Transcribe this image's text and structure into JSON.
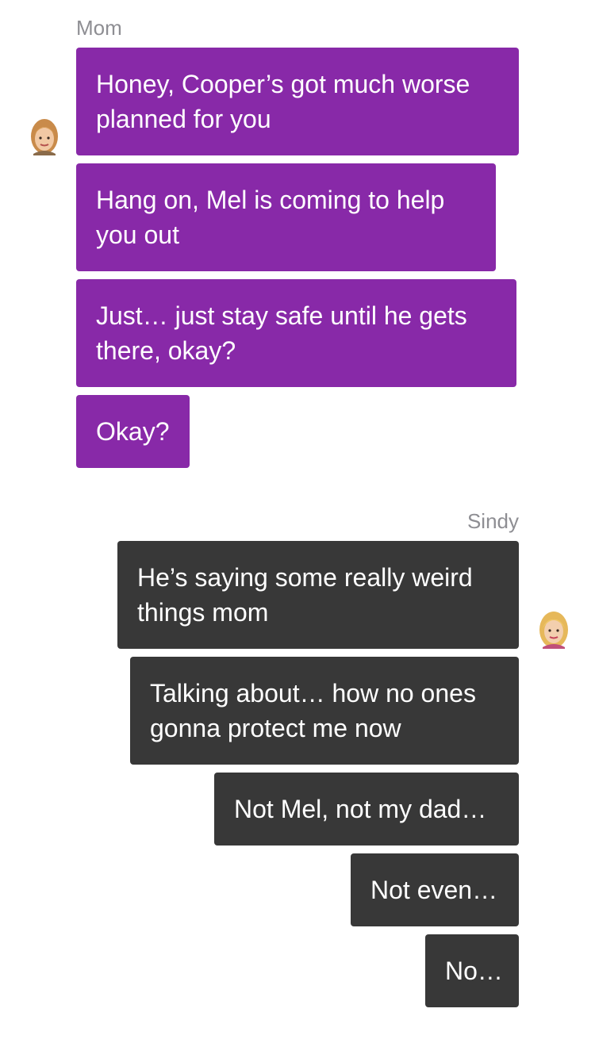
{
  "thread": {
    "incoming_sender": "Mom",
    "outgoing_sender": "Sindy",
    "incoming_messages": [
      "Honey, Cooper’s got much worse planned for you",
      "Hang on, Mel is coming to help you out",
      "Just… just stay safe until he gets there, okay?",
      "Okay?"
    ],
    "outgoing_messages": [
      "He’s saying some really weird things mom",
      "Talking about… how no ones gonna protect me now",
      "Not Mel, not my dad…",
      "Not even…",
      "No…"
    ]
  },
  "colors": {
    "incoming_bubble": "#8829a8",
    "outgoing_bubble": "#383838",
    "sender_label": "#8e8e93"
  }
}
